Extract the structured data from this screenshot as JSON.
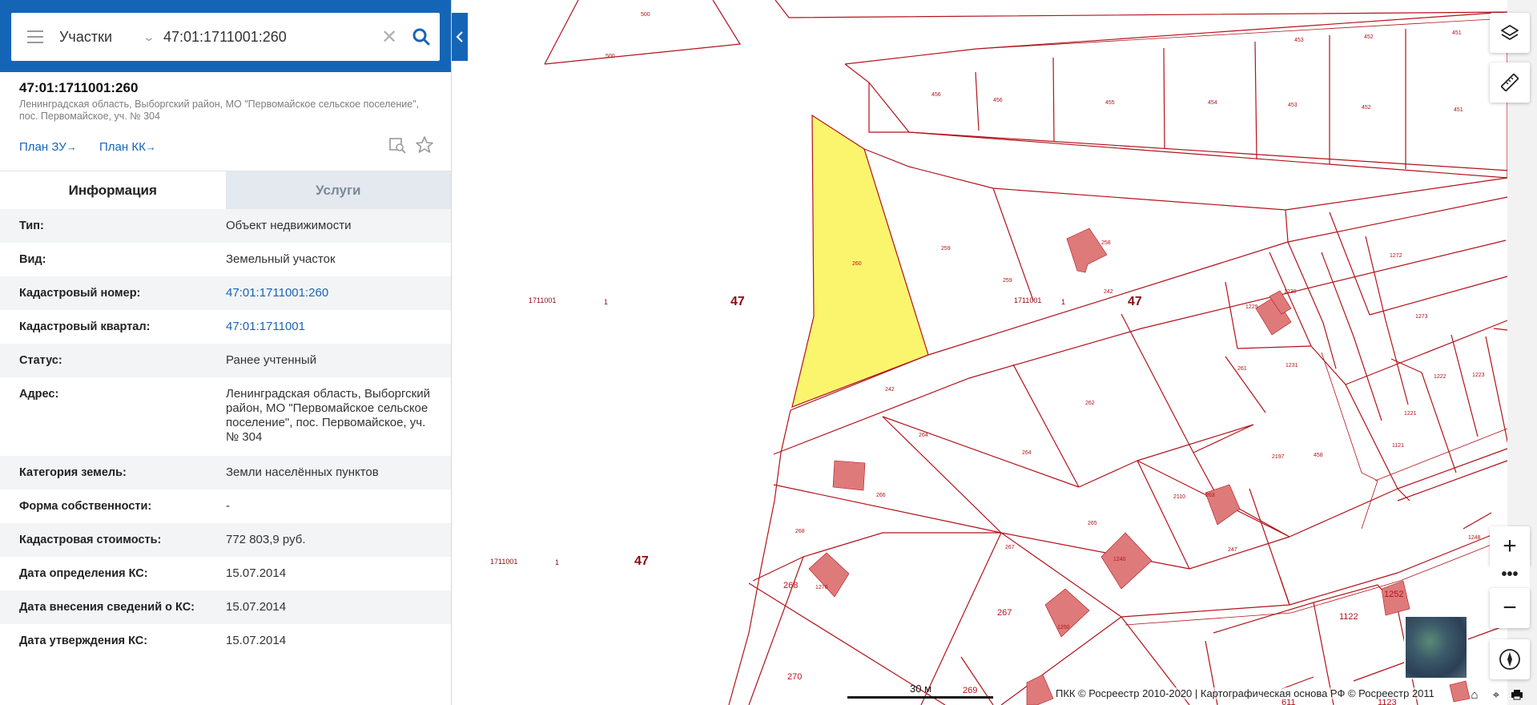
{
  "search": {
    "type_label": "Участки",
    "query": "47:01:1711001:260"
  },
  "object": {
    "title": "47:01:1711001:260",
    "address": "Ленинградская область, Выборгский район, МО \"Первомайское сельское поселение\", пос. Первомайское, уч. № 304"
  },
  "links": {
    "plan_zu": "План ЗУ",
    "plan_kk": "План КК",
    "arrow": "→"
  },
  "tabs": [
    {
      "label": "Информация"
    },
    {
      "label": "Услуги"
    }
  ],
  "info_rows": [
    {
      "key": "Тип:",
      "value": "Объект недвижимости"
    },
    {
      "key": "Вид:",
      "value": "Земельный участок"
    },
    {
      "key": "Кадастровый номер:",
      "value": "47:01:1711001:260"
    },
    {
      "key": "Кадастровый квартал:",
      "value": "47:01:1711001"
    },
    {
      "key": "Статус:",
      "value": "Ранее учтенный"
    },
    {
      "key": "Адрес:",
      "value": "Ленинградская область, Выборгский район, МО \"Первомайское сельское поселение\", пос. Первомайское, уч. № 304"
    },
    {
      "key": "Категория земель:",
      "value": "Земли населённых пунктов"
    },
    {
      "key": "Форма собственности:",
      "value": "-"
    },
    {
      "key": "Кадастровая стоимость:",
      "value": "772 803,9 руб."
    },
    {
      "key": "Дата определения КС:",
      "value": "15.07.2014"
    },
    {
      "key": "Дата внесения сведений о КС:",
      "value": "15.07.2014"
    },
    {
      "key": "Дата утверждения КС:",
      "value": "15.07.2014"
    }
  ],
  "map": {
    "colors": {
      "boundary": "#b3121a",
      "building": "#de7a7a",
      "selected": "#fbf56e",
      "panel_header": "#1565b7"
    },
    "labels": {
      "quarter_1": "1711001",
      "one_1": "1",
      "region_1": "47",
      "quarter_2": "1711001",
      "one_2": "1",
      "region_2": "47",
      "quarter_3": "1711001",
      "one_3": "1",
      "region_3": "47",
      "p500a": "500",
      "p500b": "500",
      "p456": "456",
      "p456b": "456",
      "p455": "455",
      "p454": "454",
      "p453": "453",
      "p453b": "453",
      "p452": "452",
      "p452b": "452",
      "p451": "451",
      "p451b": "451",
      "p260": "260",
      "p259": "259",
      "p259b": "259",
      "p258": "258",
      "p242": "242",
      "p242b": "242",
      "p1229": "1229",
      "p1230": "1230",
      "p1272": "1272",
      "p1273": "1273",
      "p261": "261",
      "p262": "262",
      "p1231": "1231",
      "p1222": "1222",
      "p1223": "1223",
      "p1221": "1221",
      "p1121": "1121",
      "p264": "264",
      "p264b": "264",
      "p2197": "2197",
      "p458": "458",
      "p266": "266",
      "p265": "265",
      "p2110": "2110",
      "p263": "263",
      "p268": "268",
      "p268b": "268",
      "p267": "267",
      "p267b": "267",
      "p247": "247",
      "p270": "270",
      "p269": "269",
      "p1122": "1122",
      "p1252": "1252",
      "p1123": "1123",
      "p611": "611",
      "p1248": "1248",
      "p1276": "1276",
      "p1250": "1250",
      "p1240": "1240"
    },
    "scale": "30 м",
    "copyright": "ПКК © Росреестр 2010-2020 | Картографическая основа РФ © Росреестр 2011"
  },
  "icons": {
    "menu": "hamburger-icon",
    "clear": "close-icon",
    "search": "search-icon",
    "collapse": "chevron-left-icon",
    "layers": "layers-icon",
    "ruler": "ruler-icon",
    "zoom_in": "+",
    "zoom_more": "•••",
    "zoom_out": "−",
    "compass": "compass-icon",
    "home": "⌂",
    "locate": "⌖",
    "print": "print-icon"
  }
}
